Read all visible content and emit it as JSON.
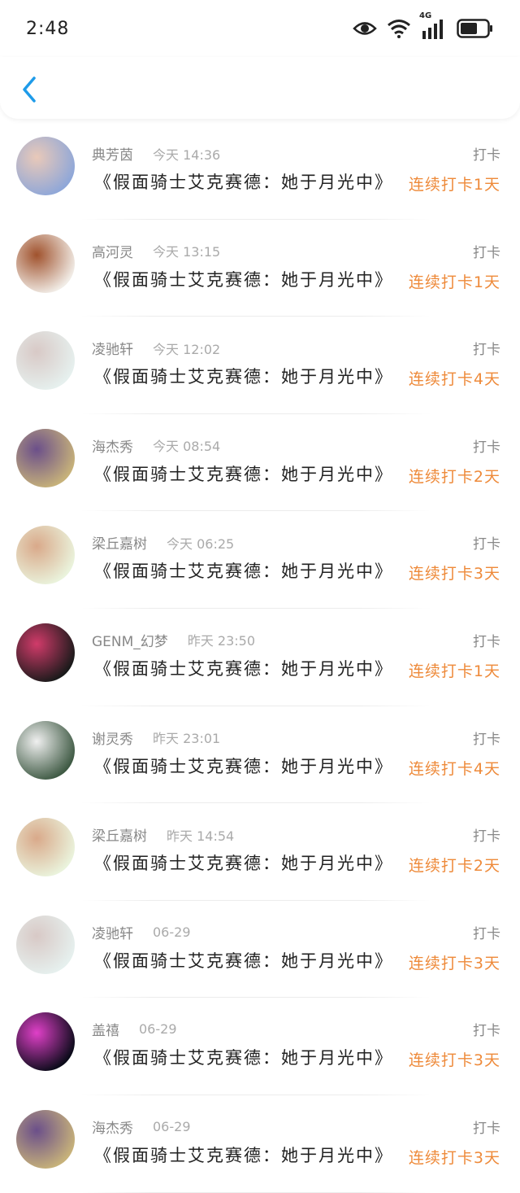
{
  "status": {
    "time": "2:48",
    "network": "4G"
  },
  "colors": {
    "accent": "#1e9be9",
    "streak": "#ee8a3a"
  },
  "items": [
    {
      "name": "典芳茵",
      "time": "今天 14:36",
      "action": "打卡",
      "title": "《假面骑士艾克赛德：她于月光中》",
      "streak": "连续打卡1天",
      "avatar": [
        "#8fa7d8",
        "#e9c9b9"
      ]
    },
    {
      "name": "高河灵",
      "time": "今天 13:15",
      "action": "打卡",
      "title": "《假面骑士艾克赛德：她于月光中》",
      "streak": "连续打卡1天",
      "avatar": [
        "#f1ece6",
        "#a0522d"
      ]
    },
    {
      "name": "凌驰轩",
      "time": "今天 12:02",
      "action": "打卡",
      "title": "《假面骑士艾克赛德：她于月光中》",
      "streak": "连续打卡4天",
      "avatar": [
        "#e6f0ee",
        "#d8c9c6"
      ]
    },
    {
      "name": "海杰秀",
      "time": "今天 08:54",
      "action": "打卡",
      "title": "《假面骑士艾克赛德：她于月光中》",
      "streak": "连续打卡2天",
      "avatar": [
        "#c7b27a",
        "#6b4f8a"
      ]
    },
    {
      "name": "梁丘嘉树",
      "time": "今天 06:25",
      "action": "打卡",
      "title": "《假面骑士艾克赛德：她于月光中》",
      "streak": "连续打卡3天",
      "avatar": [
        "#eaf3dc",
        "#d9a98a"
      ]
    },
    {
      "name": "GENM_幻梦",
      "time": "昨天 23:50",
      "action": "打卡",
      "title": "《假面骑士艾克赛德：她于月光中》",
      "streak": "连续打卡1天",
      "avatar": [
        "#1a1a1a",
        "#d13b6a"
      ]
    },
    {
      "name": "谢灵秀",
      "time": "昨天 23:01",
      "action": "打卡",
      "title": "《假面骑士艾克赛德：她于月光中》",
      "streak": "连续打卡4天",
      "avatar": [
        "#3f5a44",
        "#f0f0f0"
      ]
    },
    {
      "name": "梁丘嘉树",
      "time": "昨天 14:54",
      "action": "打卡",
      "title": "《假面骑士艾克赛德：她于月光中》",
      "streak": "连续打卡2天",
      "avatar": [
        "#eaf3dc",
        "#d9a98a"
      ]
    },
    {
      "name": "凌驰轩",
      "time": "06-29",
      "action": "打卡",
      "title": "《假面骑士艾克赛德：她于月光中》",
      "streak": "连续打卡3天",
      "avatar": [
        "#e6f0ee",
        "#d8c9c6"
      ]
    },
    {
      "name": "盖禧",
      "time": "06-29",
      "action": "打卡",
      "title": "《假面骑士艾克赛德：她于月光中》",
      "streak": "连续打卡3天",
      "avatar": [
        "#0b0b1a",
        "#e040c8"
      ]
    },
    {
      "name": "海杰秀",
      "time": "06-29",
      "action": "打卡",
      "title": "《假面骑士艾克赛德：她于月光中》",
      "streak": "连续打卡3天",
      "avatar": [
        "#c7b27a",
        "#6b4f8a"
      ]
    }
  ]
}
